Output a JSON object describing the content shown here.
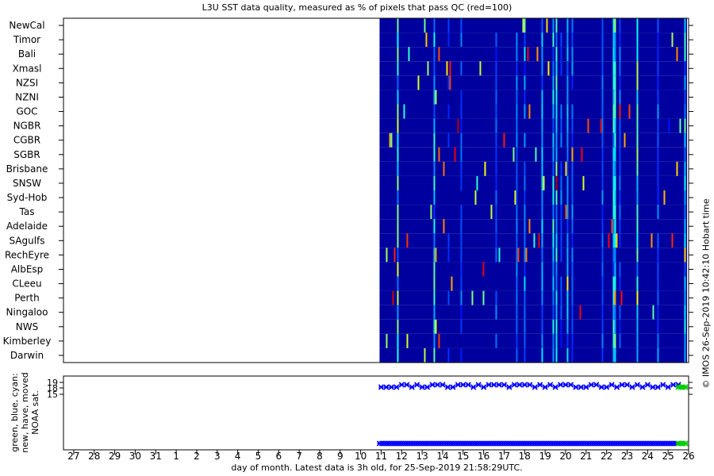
{
  "title": "L3U SST data quality, measured as % of pixels that pass QC (red=100)",
  "footer": "day of month. Latest data is 3h old, for 25-Sep-2019 21:58:29UTC.",
  "credit": "© IMOS 26-Sep-2019 10:42:10 Hobart time",
  "chart_data": [
    {
      "type": "heatmap",
      "title": "L3U SST data quality, measured as % of pixels that pass QC (red=100)",
      "regions": [
        "NewCal",
        "Timor",
        "Bali",
        "Xmasl",
        "NZSI",
        "NZNI",
        "GOC",
        "NGBR",
        "CGBR",
        "SGBR",
        "Brisbane",
        "SNSW",
        "Syd-Hob",
        "Tas",
        "Adelaide",
        "SAgulfs",
        "RechEyre",
        "AlbEsp",
        "CLeeu",
        "Perth",
        "Ningaloo",
        "NWS",
        "Kimberley",
        "Darwin"
      ],
      "x_ticks": [
        "27",
        "28",
        "29",
        "30",
        "31",
        "1",
        "2",
        "3",
        "4",
        "5",
        "6",
        "7",
        "8",
        "9",
        "10",
        "11",
        "12",
        "13",
        "14",
        "15",
        "16",
        "17",
        "18",
        "19",
        "20",
        "21",
        "22",
        "23",
        "24",
        "25",
        "26"
      ],
      "data_start_tick": "11",
      "data_end_tick": "26",
      "colormap": "jet",
      "value_range": [
        0,
        100
      ],
      "dominant_value": 3,
      "color_scale_note": "red=100"
    },
    {
      "type": "scatter",
      "ylabel_lines": [
        "green, blue, cyan:",
        "new, have, moved",
        "NOAA sat."
      ],
      "y_ticks": [
        "19",
        "18",
        "15"
      ],
      "x_ticks": [
        "27",
        "28",
        "29",
        "30",
        "31",
        "1",
        "2",
        "3",
        "4",
        "5",
        "6",
        "7",
        "8",
        "9",
        "10",
        "11",
        "12",
        "13",
        "14",
        "15",
        "16",
        "17",
        "18",
        "19",
        "20",
        "21",
        "22",
        "23",
        "24",
        "25",
        "26"
      ],
      "xlabel": "day of month. Latest data is 3h old, for 25-Sep-2019 21:58:29UTC.",
      "series": [
        {
          "name": "have",
          "color": "#0000ff",
          "x_range": [
            "11",
            "25.5"
          ],
          "levels": [
            "upper",
            "lower"
          ]
        },
        {
          "name": "new",
          "color": "#00cc00",
          "x_range": [
            "25.5",
            "26"
          ],
          "levels": [
            "upper",
            "lower"
          ]
        }
      ]
    }
  ],
  "colors": {
    "frame": "#000000",
    "heatmap_base": "#00007f",
    "have": "#0000ff",
    "new": "#00cc00"
  }
}
